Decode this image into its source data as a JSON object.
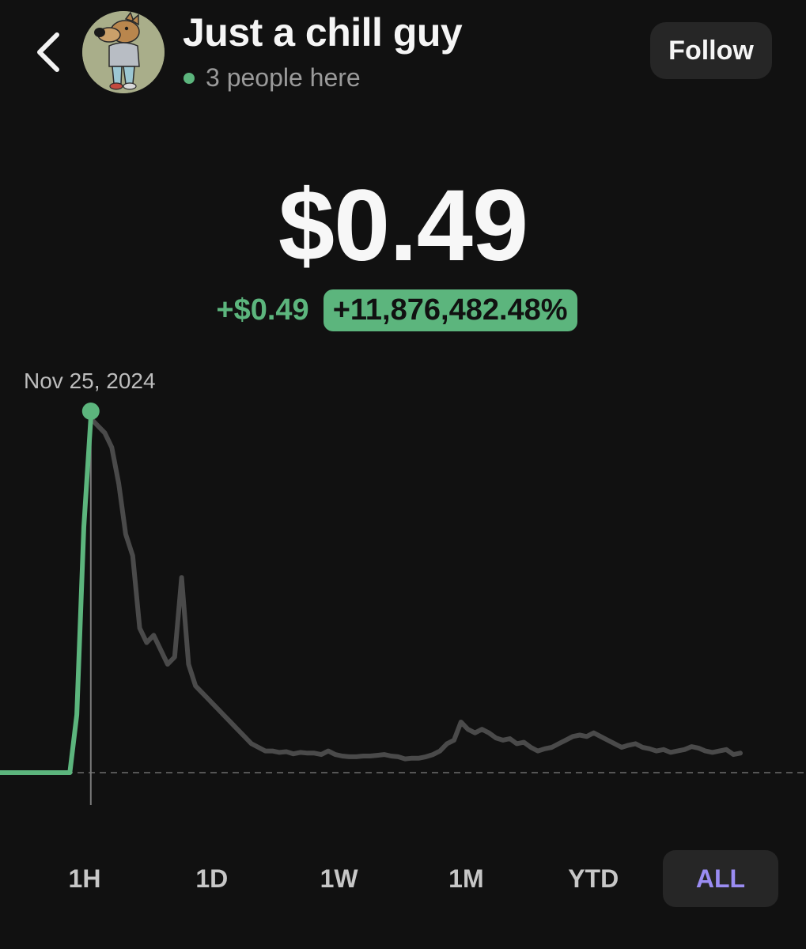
{
  "header": {
    "title": "Just a chill guy",
    "presence": "3 people here",
    "follow_label": "Follow"
  },
  "quote": {
    "price": "$0.49",
    "change_abs": "+$0.49",
    "change_pct": "+11,876,482.48%"
  },
  "chart": {
    "selected_date": "Nov 25, 2024"
  },
  "ranges": [
    "1H",
    "1D",
    "1W",
    "1M",
    "YTD",
    "ALL"
  ],
  "selected_range": "ALL",
  "icons": {
    "back": "chevron-left-icon",
    "presence": "green-dot-icon",
    "avatar": "chill-guy-dog-avatar"
  },
  "colors": {
    "background": "#111111",
    "accent_green": "#5cb57d",
    "line_gray": "#4a4a4a",
    "active_range": "#9a8cf2"
  },
  "chart_data": {
    "type": "line",
    "series": [
      {
        "values": [
          0,
          0,
          0,
          0,
          0,
          0,
          0,
          0,
          0,
          0,
          0,
          0.08,
          0.34,
          0.49,
          0.48,
          0.47,
          0.45,
          0.4,
          0.33,
          0.3,
          0.2,
          0.18,
          0.19,
          0.17,
          0.15,
          0.16,
          0.27,
          0.15,
          0.12,
          0.11,
          0.1,
          0.09,
          0.08,
          0.07,
          0.06,
          0.05,
          0.04,
          0.035,
          0.03,
          0.03,
          0.028,
          0.029,
          0.026,
          0.028,
          0.027,
          0.027,
          0.025,
          0.03,
          0.025,
          0.023,
          0.022,
          0.022,
          0.023,
          0.023,
          0.024,
          0.025,
          0.023,
          0.022,
          0.019,
          0.02,
          0.02,
          0.022,
          0.025,
          0.03,
          0.04,
          0.045,
          0.07,
          0.06,
          0.055,
          0.06,
          0.055,
          0.048,
          0.045,
          0.047,
          0.04,
          0.042,
          0.035,
          0.03,
          0.033,
          0.035,
          0.04,
          0.045,
          0.05,
          0.052,
          0.05,
          0.055,
          0.05,
          0.045,
          0.04,
          0.035,
          0.038,
          0.04,
          0.035,
          0.033,
          0.03,
          0.032,
          0.028,
          0.03,
          0.032,
          0.036,
          0.034,
          0.03,
          0.028,
          0.03,
          0.032,
          0.025,
          0.027
        ]
      }
    ],
    "highlight_index": 13,
    "highlight_label": "Nov 25, 2024",
    "baseline": 0,
    "ylim": [
      0,
      0.5
    ],
    "grid": false,
    "colors": {
      "before_highlight": "#5cb57d",
      "after_highlight": "#4a4a4a"
    }
  }
}
